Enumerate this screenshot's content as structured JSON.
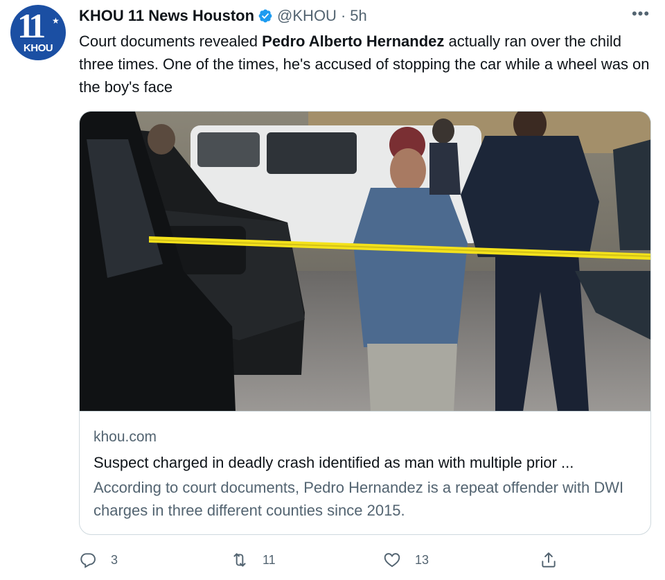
{
  "account": {
    "avatar_number": "11",
    "avatar_callsign": "KHOU",
    "display_name": "KHOU 11 News Houston",
    "handle": "@KHOU",
    "separator": "·",
    "time_ago": "5h"
  },
  "tweet": {
    "text_before": "Court documents revealed ",
    "text_bold": "Pedro Alberto Hernandez",
    "text_after": " actually ran over the child three times. One of the times, he's accused of stopping the car while a wheel was on the boy's face"
  },
  "card": {
    "domain": "khou.com",
    "title": "Suspect charged in deadly crash identified as man with multiple prior ...",
    "description": "According to court documents, Pedro Hernandez is a repeat offender with DWI charges in three different counties since 2015."
  },
  "actions": {
    "replies": "3",
    "retweets": "11",
    "likes": "13"
  },
  "colors": {
    "text_primary": "#0f1419",
    "text_secondary": "#536471",
    "verified": "#1d9bf0",
    "border": "#cfd9de",
    "avatar_bg": "#1b4fa3",
    "police_tape": "#f4e21b"
  },
  "icons": {
    "verified": "verified-badge-icon",
    "more": "more-horizontal-icon",
    "reply": "reply-icon",
    "retweet": "retweet-icon",
    "like": "heart-icon",
    "share": "share-icon"
  }
}
